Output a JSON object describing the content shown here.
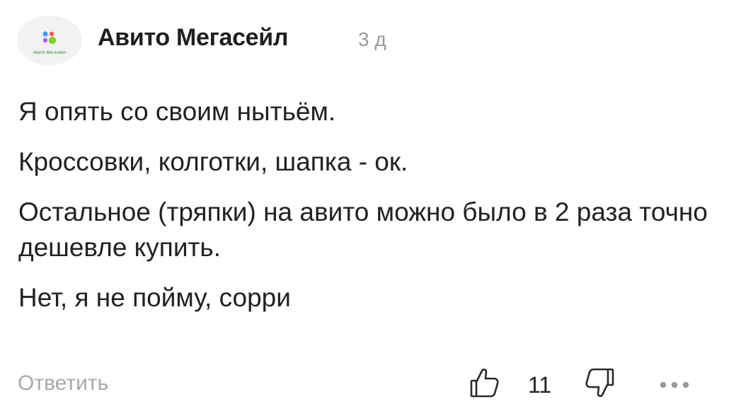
{
  "author": {
    "name": "Авито Мегасейл",
    "avatar_caption": "Авито Мегасейл",
    "avatar_icon": "avito-logo-icon"
  },
  "time": "3 д",
  "paragraphs": [
    "Я опять со своим нытьём.",
    "Кроссовки, колготки, шапка - ок.",
    "Остальное (тряпки) на авито можно было в 2 раза точно дешевле купить.",
    "Нет, я не пойму, сорри"
  ],
  "actions": {
    "reply_label": "Ответить",
    "like_count": "11",
    "like_icon": "thumbs-up-icon",
    "dislike_icon": "thumbs-down-icon",
    "more_icon": "more-dots-icon"
  },
  "colors": {
    "avito_green": "#2e8b3d",
    "avito_blue": "#3aa0ff",
    "avito_purple": "#b45bff",
    "avito_lime": "#7ed321",
    "muted_text": "#a8a8a8"
  }
}
